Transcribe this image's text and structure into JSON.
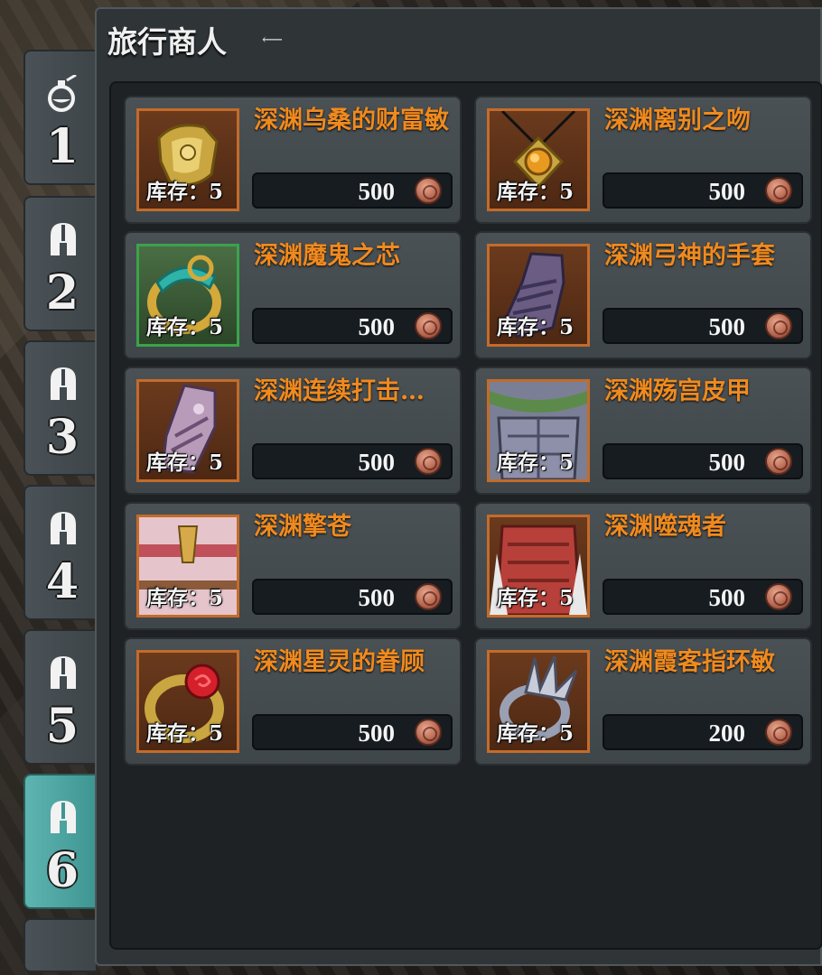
{
  "shop": {
    "title": "旅行商人",
    "back_icon": "back-arrow-icon"
  },
  "tabs": [
    {
      "label": "1",
      "icon": "potion-icon",
      "active": false
    },
    {
      "label": "2",
      "icon": "helmet-icon",
      "active": false
    },
    {
      "label": "3",
      "icon": "helmet-icon",
      "active": false
    },
    {
      "label": "4",
      "icon": "helmet-icon",
      "active": false
    },
    {
      "label": "5",
      "icon": "helmet-icon",
      "active": false
    },
    {
      "label": "6",
      "icon": "helmet-icon",
      "active": true
    }
  ],
  "items": [
    {
      "name": "深渊乌桑的财富敏",
      "stock": "库存：5",
      "price": "500",
      "icon": "bracer-icon",
      "rarity_color": "#c46b2a"
    },
    {
      "name": "深渊离别之吻",
      "stock": "库存：5",
      "price": "500",
      "icon": "amulet-icon",
      "rarity_color": "#c46b2a"
    },
    {
      "name": "深渊魔鬼之芯",
      "stock": "库存：5",
      "price": "500",
      "icon": "ring-icon",
      "rarity_color": "#3aa34a"
    },
    {
      "name": "深渊弓神的手套",
      "stock": "库存：5",
      "price": "500",
      "icon": "gauntlet-icon",
      "rarity_color": "#c46b2a"
    },
    {
      "name": "深渊连续打击…",
      "stock": "库存：5",
      "price": "500",
      "icon": "glove-icon",
      "rarity_color": "#c46b2a"
    },
    {
      "name": "深渊殇宫皮甲",
      "stock": "库存：5",
      "price": "500",
      "icon": "leather-armor-icon",
      "rarity_color": "#c46b2a"
    },
    {
      "name": "深渊擎苍",
      "stock": "库存：5",
      "price": "500",
      "icon": "plate-armor-icon",
      "rarity_color": "#c46b2a"
    },
    {
      "name": "深渊噬魂者",
      "stock": "库存：5",
      "price": "500",
      "icon": "dragon-armor-icon",
      "rarity_color": "#c46b2a"
    },
    {
      "name": "深渊星灵的眷顾",
      "stock": "库存：5",
      "price": "500",
      "icon": "ruby-ring-icon",
      "rarity_color": "#c46b2a"
    },
    {
      "name": "深渊霞客指环敏",
      "stock": "库存：5",
      "price": "200",
      "icon": "spiked-ring-icon",
      "rarity_color": "#c46b2a"
    }
  ],
  "currency_icon": "coin-icon"
}
